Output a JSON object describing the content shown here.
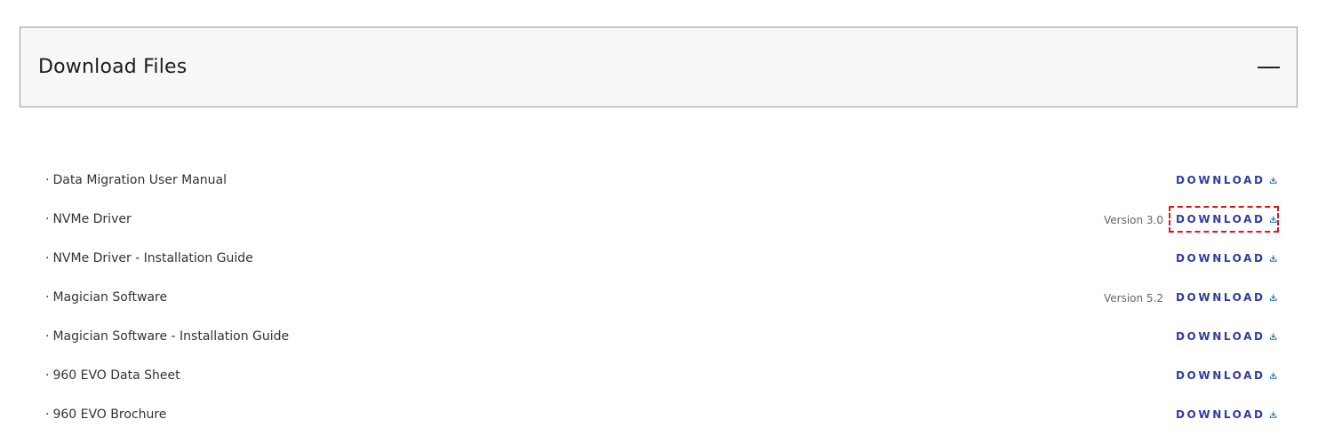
{
  "section": {
    "title": "Download Files",
    "toggle_icon": "minus-collapse-icon"
  },
  "files": [
    {
      "name": "Data Migration User Manual",
      "version": "",
      "download_label": "DOWNLOAD"
    },
    {
      "name": "NVMe Driver",
      "version": "Version 3.0",
      "download_label": "DOWNLOAD",
      "highlighted": true
    },
    {
      "name": "NVMe Driver - Installation Guide",
      "version": "",
      "download_label": "DOWNLOAD"
    },
    {
      "name": "Magician Software",
      "version": "Version 5.2",
      "download_label": "DOWNLOAD"
    },
    {
      "name": "Magician Software - Installation Guide",
      "version": "",
      "download_label": "DOWNLOAD"
    },
    {
      "name": "960 EVO Data Sheet",
      "version": "",
      "download_label": "DOWNLOAD"
    },
    {
      "name": "960 EVO Brochure",
      "version": "",
      "download_label": "DOWNLOAD"
    }
  ],
  "colors": {
    "download_text": "#2f3da0",
    "download_icon": "#1f6fb5",
    "highlight_outline": "#e0141e",
    "header_bg": "#f7f7f7"
  }
}
